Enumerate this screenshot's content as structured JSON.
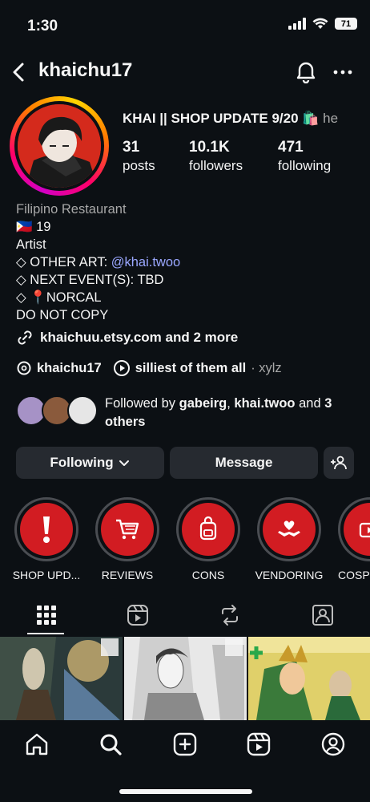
{
  "status": {
    "time": "1:30",
    "battery": "71"
  },
  "header": {
    "username": "khaichu17"
  },
  "profile": {
    "display_name": "KHAI || SHOP UPDATE 9/20 🛍️",
    "pronouns": "he",
    "stats": [
      {
        "value": "31",
        "label": "posts"
      },
      {
        "value": "10.1K",
        "label": "followers"
      },
      {
        "value": "471",
        "label": "following"
      }
    ]
  },
  "bio": {
    "category": "Filipino Restaurant",
    "line1": "🇵🇭 19",
    "line2": "Artist",
    "line3_prefix": "◇ OTHER ART: ",
    "line3_mention": "@khai.twoo",
    "line4": "◇ NEXT EVENT(S): TBD",
    "line5": "◇ 📍NORCAL",
    "line6": "DO NOT COPY"
  },
  "link": {
    "text": "khaichuu.etsy.com and 2 more"
  },
  "threads": {
    "handle": "khaichu17",
    "music": "silliest of them all",
    "artist": "· xylz"
  },
  "followed_by": {
    "prefix": "Followed by ",
    "user1": "gabeirg",
    "sep": ", ",
    "user2": "khai.twoo",
    "mid": " and ",
    "rest": "3 others"
  },
  "actions": {
    "following": "Following",
    "message": "Message"
  },
  "highlights": [
    {
      "label": "SHOP UPD...",
      "icon": "exclamation-icon"
    },
    {
      "label": "REVIEWS",
      "icon": "cart-icon"
    },
    {
      "label": "CONS",
      "icon": "backpack-icon"
    },
    {
      "label": "VENDORING",
      "icon": "hands-heart-icon"
    },
    {
      "label": "COSP",
      "icon": "video-icon"
    }
  ],
  "colors": {
    "background": "#0c1014",
    "button": "#262a30",
    "highlight_red": "#d21c22",
    "mention": "#9aa7ff"
  }
}
